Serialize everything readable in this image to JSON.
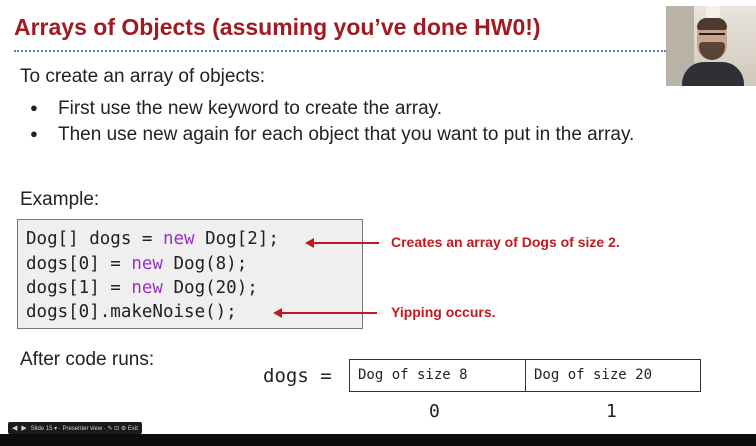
{
  "slide": {
    "title": "Arrays of Objects (assuming you’ve done HW0!)",
    "intro": "To create an array of objects:",
    "bullets": [
      "First use the new keyword to create the array.",
      "Then use new again for each object that you want to put in the array."
    ],
    "example_label": "Example:",
    "code": {
      "line1_pre": "Dog[] dogs = ",
      "line1_kw": "new",
      "line1_post": " Dog[2];",
      "line2_pre": "dogs[0] = ",
      "line2_kw": "new",
      "line2_post": " Dog(8);",
      "line3_pre": "dogs[1] = ",
      "line3_kw": "new",
      "line3_post": " Dog(20);",
      "line4": "dogs[0].makeNoise();"
    },
    "annotations": {
      "create": "Creates an array of Dogs of size 2.",
      "yip": "Yipping occurs."
    },
    "after_label": "After code runs:",
    "diagram": {
      "var_label": "dogs = ",
      "cells": [
        "Dog of size 8",
        "Dog of size 20"
      ],
      "indices": [
        "0",
        "1"
      ]
    }
  },
  "player": {
    "controls_text": "Slide 15 ▾ · Presenter view · ✎ ⊡ ⚙ Exit"
  },
  "colors": {
    "title": "#a01b21",
    "annotation": "#c2191f",
    "keyword": "#9b30c8"
  }
}
